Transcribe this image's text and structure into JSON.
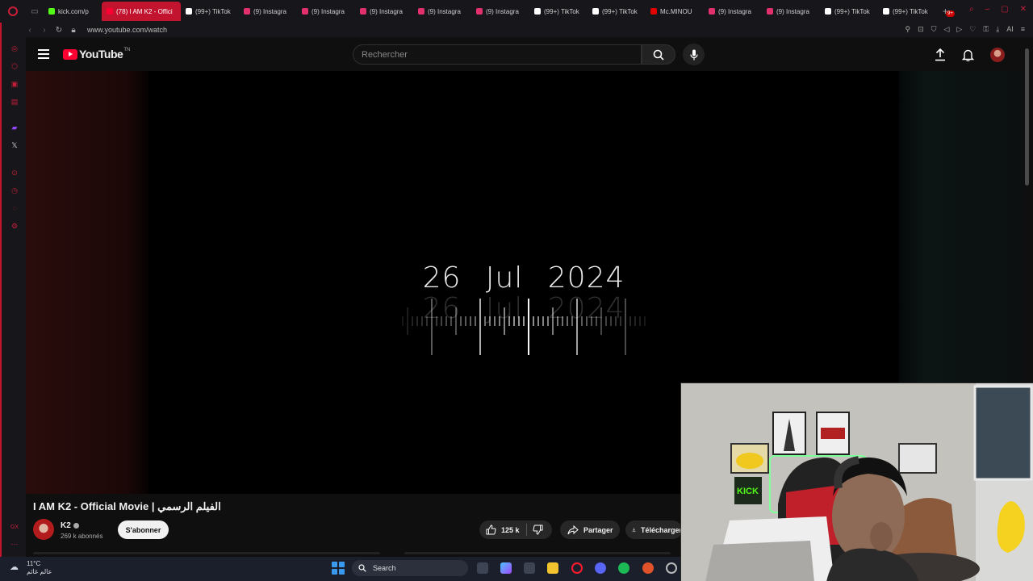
{
  "browser": {
    "tabs": [
      {
        "label": "kick.com/p",
        "color": "#53fc18"
      },
      {
        "label": "(78) I AM K2 - Offici",
        "color": "#ff0033",
        "active": true
      },
      {
        "label": "(99+) TikTok",
        "color": "#ffffff"
      },
      {
        "label": "(9) Instagra",
        "color": "#e1306c"
      },
      {
        "label": "(9) Instagra",
        "color": "#e1306c"
      },
      {
        "label": "(9) Instagra",
        "color": "#e1306c"
      },
      {
        "label": "(9) Instagra",
        "color": "#e1306c"
      },
      {
        "label": "(9) Instagra",
        "color": "#e1306c"
      },
      {
        "label": "(99+) TikTok",
        "color": "#ffffff"
      },
      {
        "label": "(99+) TikTok",
        "color": "#ffffff"
      },
      {
        "label": "Mc.MINOU",
        "color": "#e00000"
      },
      {
        "label": "(9) Instagra",
        "color": "#e1306c"
      },
      {
        "label": "(9) Instagra",
        "color": "#e1306c"
      },
      {
        "label": "(99+) TikTok",
        "color": "#ffffff"
      },
      {
        "label": "(99+) TikTok",
        "color": "#ffffff"
      }
    ],
    "url": "www.youtube.com/watch",
    "ai_label": "AI"
  },
  "youtube": {
    "logo_text": "YouTube",
    "region": "TN",
    "search_placeholder": "Rechercher",
    "notifications_badge": "9+",
    "accent": "#ff0033"
  },
  "video": {
    "frame_text": "26   Jul   2024",
    "title": "I AM K2 - Official Movie | الفيلم الرسمي",
    "channel": "K2",
    "subscribers": "269 k abonnés",
    "subscribe_label": "S'abonner",
    "likes": "125 k",
    "share_label": "Partager",
    "download_label": "Télécharger"
  },
  "taskbar": {
    "temperature": "11°C",
    "weather_text": "عالم غائم",
    "search_label": "Search"
  }
}
